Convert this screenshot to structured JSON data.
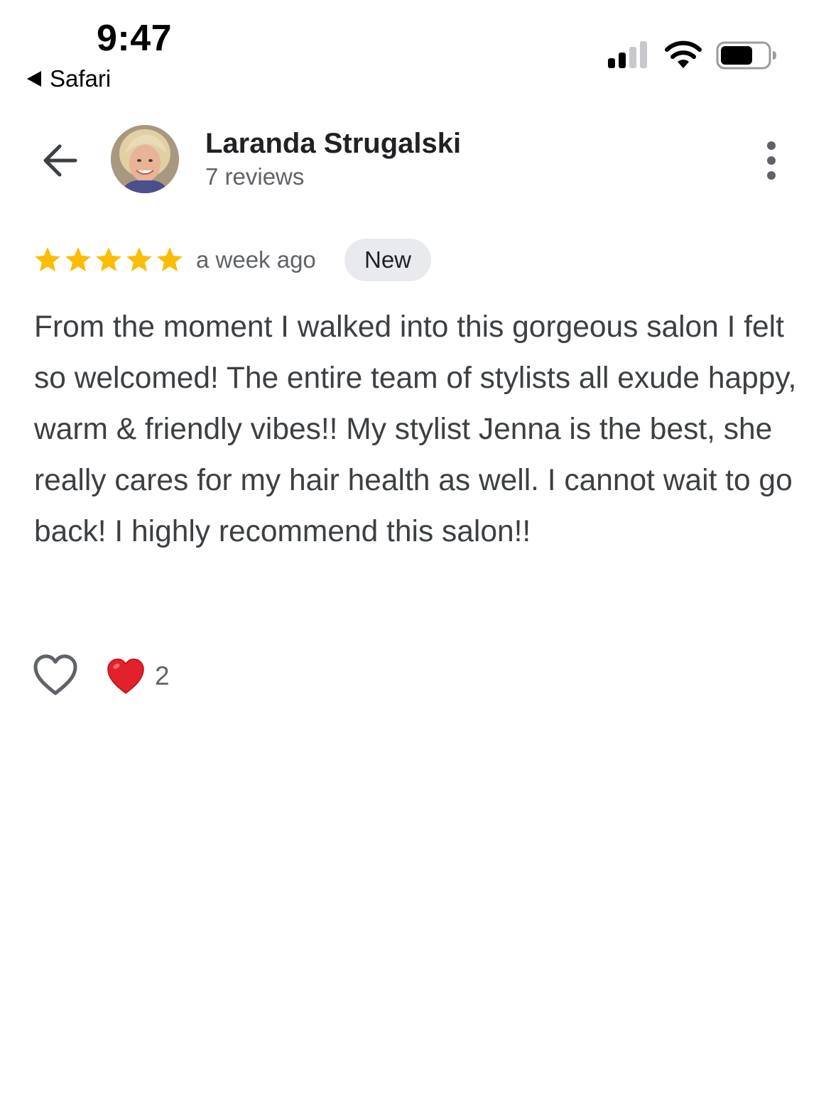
{
  "status_bar": {
    "time": "9:47",
    "back_app_label": "Safari",
    "signal_icon": "cellular-signal-icon",
    "wifi_icon": "wifi-icon",
    "battery_icon": "battery-icon"
  },
  "header": {
    "back_icon": "arrow-left-icon",
    "reviewer_name": "Laranda Strugalski",
    "review_count": "7 reviews",
    "more_icon": "more-vertical-icon"
  },
  "review": {
    "rating": 5,
    "rating_max": 5,
    "star_color": "#fbbc04",
    "time_ago": "a week ago",
    "badge": "New",
    "text": "From the moment I walked into this gorgeous salon I felt so welcomed! The entire team of stylists all exude happy, warm & friendly vibes!! My stylist Jenna is the best, she really cares for my hair health as well. I cannot wait to go back! I highly recommend this salon!!"
  },
  "reactions": {
    "like_icon": "heart-outline-icon",
    "reaction_icon": "red-heart-icon",
    "reaction_count": "2"
  }
}
